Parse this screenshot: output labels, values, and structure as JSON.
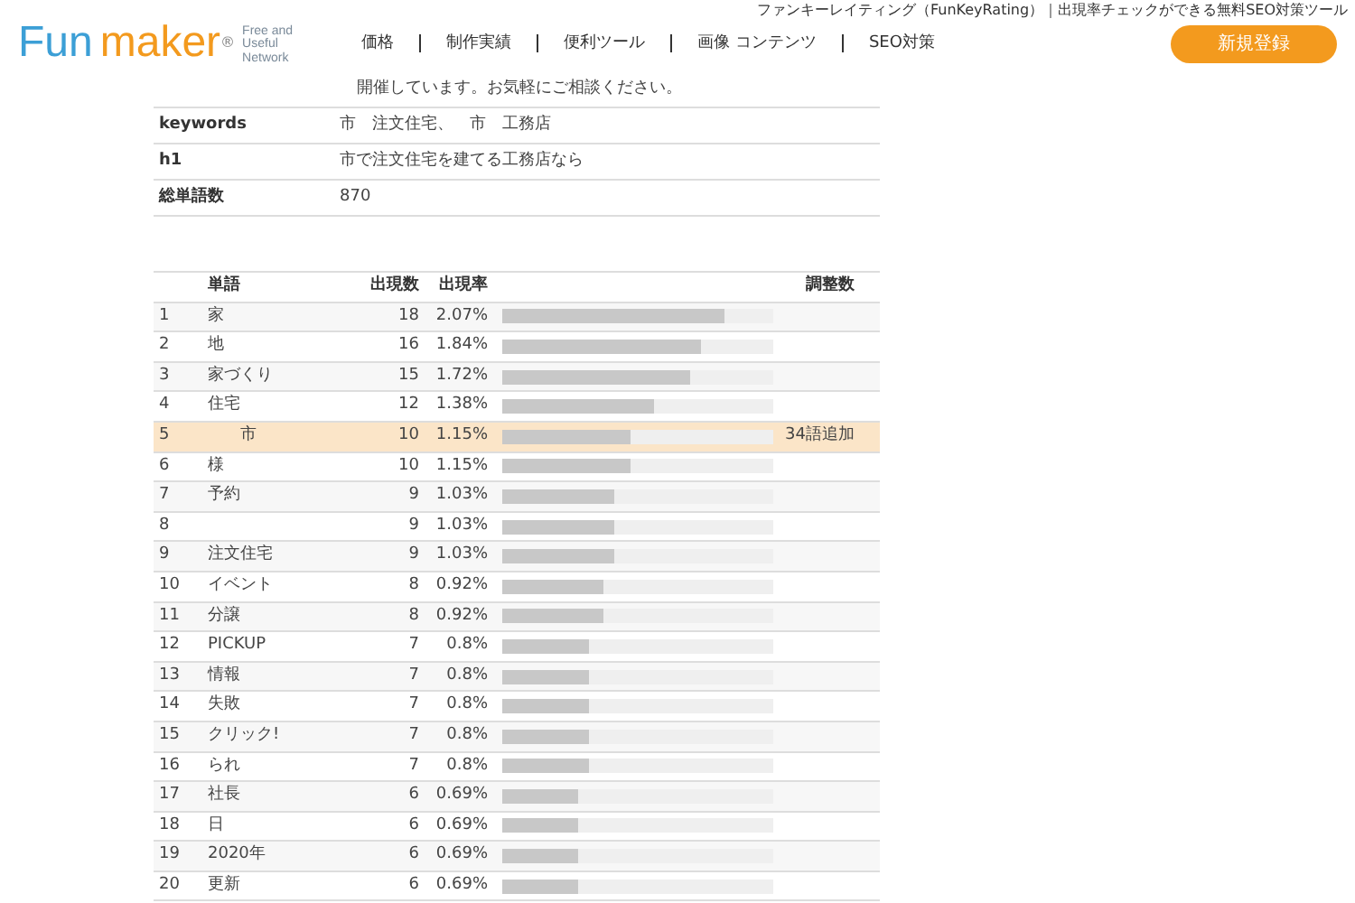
{
  "header": {
    "tagline": "ファンキーレイティング（FunKeyRating）｜出現率チェックができる無料SEO対策ツール",
    "logo": {
      "part_1": "Fun",
      "part_2": "maker",
      "mark": "®",
      "subtitle": [
        "Free and",
        "Useful",
        "Network"
      ]
    },
    "nav": [
      "価格",
      "制作実績",
      "便利ツール",
      "画像 コンテンツ",
      "SEO対策"
    ],
    "register_button": "新規登録"
  },
  "info": {
    "intro": "開催しています。お気軽にご相談ください。",
    "rows": [
      {
        "label": "keywords",
        "value": "市　注文住宅、　市　工務店"
      },
      {
        "label": "h1",
        "value": "市で注文住宅を建てる工務店なら"
      },
      {
        "label": "総単語数",
        "value": "870"
      }
    ]
  },
  "table": {
    "columns": [
      "単語",
      "出現数",
      "出現率",
      "調整数"
    ],
    "rows": [
      {
        "rank": "1",
        "word": "家",
        "count": "18",
        "rate": "2.07%",
        "level": 0.82,
        "selected": false
      },
      {
        "rank": "2",
        "word": "地",
        "count": "16",
        "rate": "1.84%",
        "level": 0.73,
        "selected": false
      },
      {
        "rank": "3",
        "word": "家づくり",
        "count": "15",
        "rate": "1.72%",
        "level": 0.69,
        "selected": false
      },
      {
        "rank": "4",
        "word": "住宅",
        "count": "12",
        "rate": "1.38%",
        "level": 0.56,
        "selected": false
      },
      {
        "rank": "5",
        "word": "市",
        "count": "10",
        "rate": "1.15%",
        "level": 0.47,
        "selected": true,
        "adjust": "34語追加"
      },
      {
        "rank": "6",
        "word": "様",
        "count": "10",
        "rate": "1.15%",
        "level": 0.47,
        "selected": false
      },
      {
        "rank": "7",
        "word": "予約",
        "count": "9",
        "rate": "1.03%",
        "level": 0.41,
        "selected": false
      },
      {
        "rank": "8",
        "count": "9",
        "rate": "1.03%",
        "level": 0.41,
        "selected": false
      },
      {
        "rank": "9",
        "word": "注文住宅",
        "count": "9",
        "rate": "1.03%",
        "level": 0.41,
        "selected": false
      },
      {
        "rank": "10",
        "word": "イベント",
        "count": "8",
        "rate": "0.92%",
        "level": 0.37,
        "selected": false
      },
      {
        "rank": "11",
        "word": "分譲",
        "count": "8",
        "rate": "0.92%",
        "level": 0.37,
        "selected": false
      },
      {
        "rank": "12",
        "word": "PICKUP",
        "count": "7",
        "rate": "0.8%",
        "level": 0.32,
        "selected": false
      },
      {
        "rank": "13",
        "word": "情報",
        "count": "7",
        "rate": "0.8%",
        "level": 0.32,
        "selected": false
      },
      {
        "rank": "14",
        "word": "失敗",
        "count": "7",
        "rate": "0.8%",
        "level": 0.32,
        "selected": false
      },
      {
        "rank": "15",
        "word": "クリック!",
        "count": "7",
        "rate": "0.8%",
        "level": 0.32,
        "selected": false
      },
      {
        "rank": "16",
        "word": "られ",
        "count": "7",
        "rate": "0.8%",
        "level": 0.32,
        "selected": false
      },
      {
        "rank": "17",
        "word": "社長",
        "count": "6",
        "rate": "0.69%",
        "level": 0.28,
        "selected": false
      },
      {
        "rank": "18",
        "word": "日",
        "count": "6",
        "rate": "0.69%",
        "level": 0.28,
        "selected": false
      },
      {
        "rank": "19",
        "word": "2020年",
        "count": "6",
        "rate": "0.69%",
        "level": 0.28,
        "selected": false
      },
      {
        "rank": "20",
        "word": "更新",
        "count": "6",
        "rate": "0.69%",
        "level": 0.28,
        "selected": false
      }
    ]
  }
}
